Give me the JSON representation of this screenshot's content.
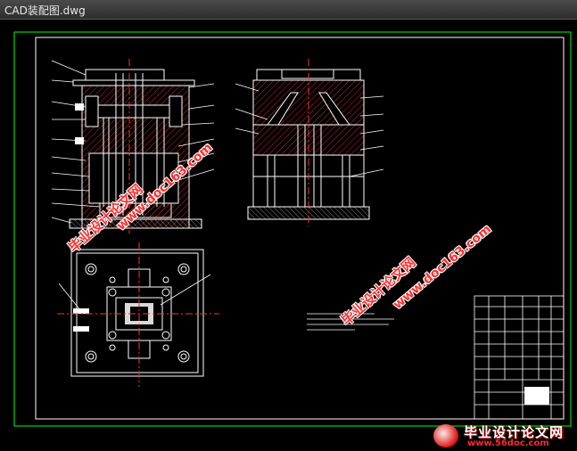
{
  "window": {
    "title": "CAD装配图.dwg"
  },
  "watermarks": {
    "site_cn": "毕业设计论文网",
    "site_url": "www.doc163.com",
    "corner_cn": "毕业设计论文网",
    "corner_url": "www.56doc.com"
  },
  "colors": {
    "background": "#000000",
    "frame": "#ffffff",
    "title_frame": "#00ff00",
    "hatch": "#ff3030",
    "centerline": "#ff3030",
    "leader": "#ffffff",
    "watermark": "#ff3030"
  },
  "icons": {
    "corner_logo": "globe-icon"
  }
}
